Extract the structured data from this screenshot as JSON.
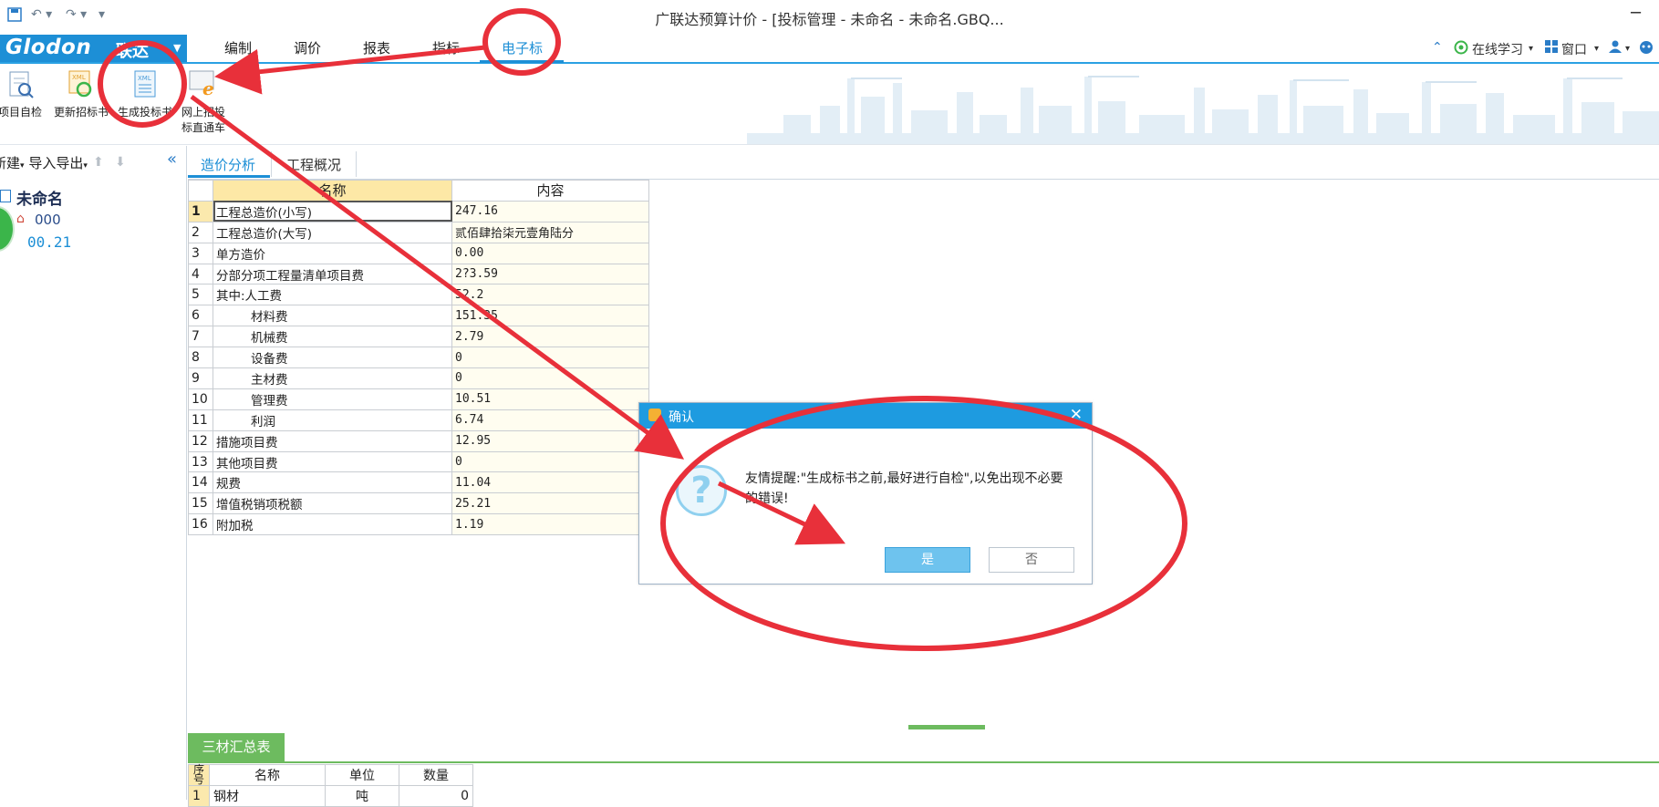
{
  "title_bar": {
    "title": "广联达预算计价 - [投标管理 - 未命名 - 未命名.GBQ...",
    "minimize": "─"
  },
  "menubar": {
    "logo_text": "Glodon",
    "logo_cn": "联达",
    "items": [
      "编制",
      "调价",
      "报表",
      "指标",
      "电子标"
    ],
    "active_index": 4,
    "right": {
      "online_learning": "在线学习",
      "window": "窗口"
    }
  },
  "ribbon": {
    "buttons": [
      {
        "label": "项目自检",
        "icon": "check-document-icon"
      },
      {
        "label": "更新招标书",
        "icon": "refresh-xml-icon"
      },
      {
        "label": "生成投标书",
        "icon": "xml-document-icon"
      },
      {
        "label_line1": "网上招投",
        "label_line2": "标直通车",
        "icon": "ie-browser-icon"
      }
    ]
  },
  "left_panel": {
    "toolbar": {
      "new": "新建",
      "import_export": "导入导出"
    },
    "tree": {
      "root": "未命名",
      "child": "000",
      "value": "00.21"
    }
  },
  "tabs": [
    "造价分析",
    "工程概况"
  ],
  "grid": {
    "headers": {
      "name": "名称",
      "content": "内容"
    },
    "rows": [
      {
        "no": "1",
        "name": "工程总造价(小写)",
        "value": "247.16",
        "indent": false
      },
      {
        "no": "2",
        "name": "工程总造价(大写)",
        "value": "贰佰肆拾柒元壹角陆分",
        "indent": false
      },
      {
        "no": "3",
        "name": "单方造价",
        "value": "0.00",
        "indent": false
      },
      {
        "no": "4",
        "name": "分部分项工程量清单项目费",
        "value": "2?3.59",
        "indent": false
      },
      {
        "no": "5",
        "name": "其中:人工费",
        "value": "52.2",
        "indent": false
      },
      {
        "no": "6",
        "name": "材料费",
        "value": "151.35",
        "indent": true
      },
      {
        "no": "7",
        "name": "机械费",
        "value": "2.79",
        "indent": true
      },
      {
        "no": "8",
        "name": "设备费",
        "value": "0",
        "indent": true
      },
      {
        "no": "9",
        "name": "主材费",
        "value": "0",
        "indent": true
      },
      {
        "no": "10",
        "name": "管理费",
        "value": "10.51",
        "indent": true
      },
      {
        "no": "11",
        "name": "利润",
        "value": "6.74",
        "indent": true
      },
      {
        "no": "12",
        "name": "措施项目费",
        "value": "12.95",
        "indent": false
      },
      {
        "no": "13",
        "name": "其他项目费",
        "value": "0",
        "indent": false
      },
      {
        "no": "14",
        "name": "规费",
        "value": "11.04",
        "indent": false
      },
      {
        "no": "15",
        "name": "增值税销项税额",
        "value": "25.21",
        "indent": false
      },
      {
        "no": "16",
        "name": "附加税",
        "value": "1.19",
        "indent": false
      }
    ]
  },
  "bottom": {
    "tab": "三材汇总表",
    "headers": {
      "seq": "序号",
      "name": "名称",
      "unit": "单位",
      "qty": "数量"
    },
    "rows": [
      {
        "no": "1",
        "name": "钢材",
        "unit": "吨",
        "qty": "0"
      }
    ]
  },
  "dialog": {
    "title": "确认",
    "close": "✕",
    "message": "友情提醒:\"生成标书之前,最好进行自检\",以免出现不必要的错误!",
    "yes": "是",
    "no": "否"
  },
  "colors": {
    "accent": "#1d8fd6",
    "annotation": "#e8303a",
    "green": "#6dbb5f"
  }
}
